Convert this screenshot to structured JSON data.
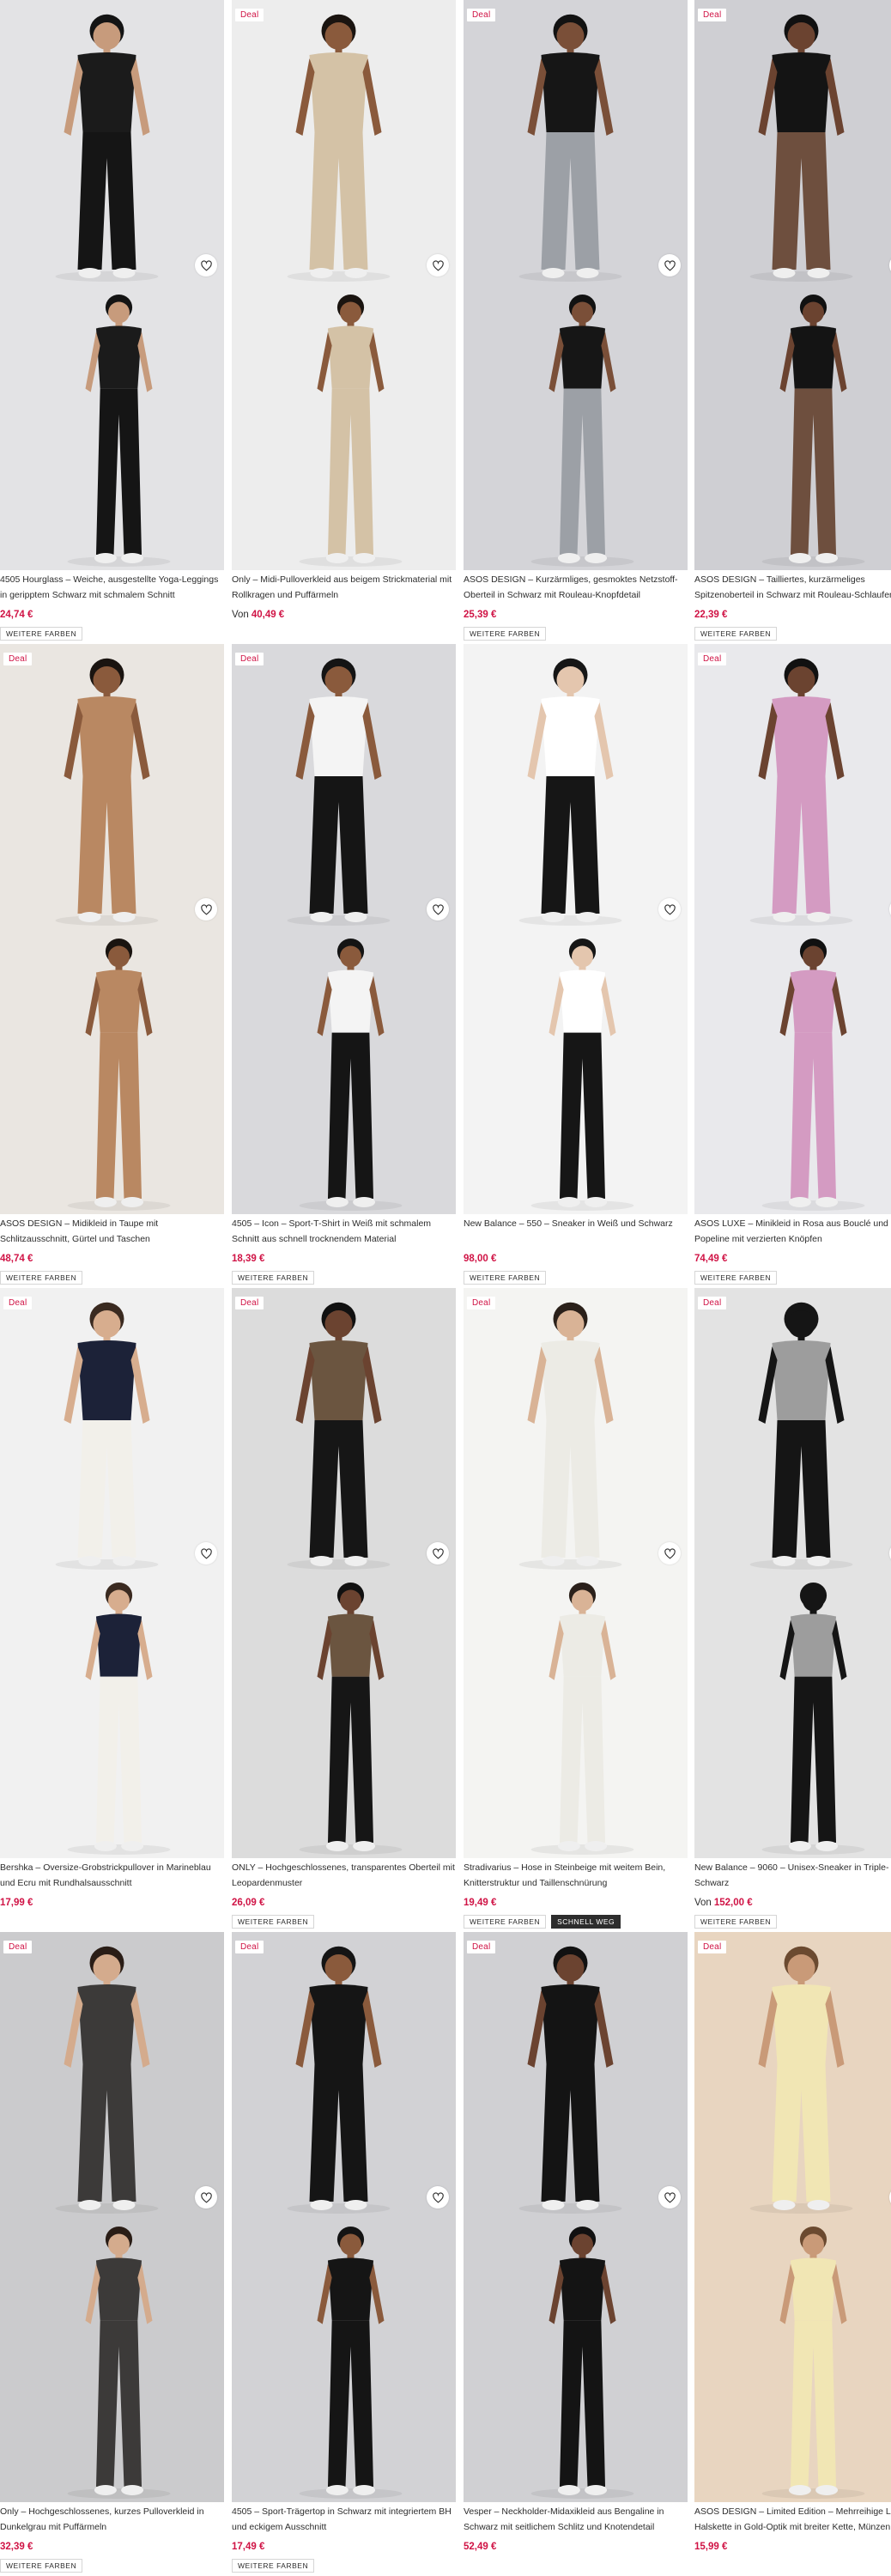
{
  "colors": {
    "deal_text": "#d01345",
    "price": "#d01345",
    "text": "#2d2d2d",
    "chip_border": "#d6d6d6"
  },
  "products": [
    {
      "deal": "",
      "title": "4505 Hourglass – Weiche, ausgestellte Yoga-Leggings in geripptem Schwarz mit schmalem Schnitt",
      "price_prefix": "",
      "price": "24,74 €",
      "chips": [
        "WEITERE FARBEN"
      ],
      "palette": {
        "bg": "#e3e3e5",
        "top": "#1b1b1b",
        "bottom": "#151515",
        "skin": "#c79b7c",
        "hair": "#141414"
      }
    },
    {
      "deal": "Deal",
      "title": "Only – Midi-Pulloverkleid aus beigem Strickmaterial mit Rollkragen und Puffärmeln",
      "price_prefix": "Von",
      "price": "40,49 €",
      "chips": [],
      "palette": {
        "bg": "#ededed",
        "top": "#d4c2a6",
        "bottom": "#d4c2a6",
        "skin": "#8a5a3c",
        "hair": "#1a1410"
      }
    },
    {
      "deal": "Deal",
      "title": "ASOS DESIGN – Kurzärmliges, gesmoktes Netzstoff-Oberteil in Schwarz mit Rouleau-Knopfdetail",
      "price_prefix": "",
      "price": "25,39 €",
      "chips": [
        "WEITERE FARBEN"
      ],
      "palette": {
        "bg": "#d4d4d8",
        "top": "#161616",
        "bottom": "#9ca0a6",
        "skin": "#7a4f38",
        "hair": "#121212"
      }
    },
    {
      "deal": "Deal",
      "title": "ASOS DESIGN – Tailliertes, kurzärmeliges Spitzenoberteil in Schwarz mit Rouleau-Schlaufen",
      "price_prefix": "",
      "price": "22,39 €",
      "chips": [
        "WEITERE FARBEN"
      ],
      "palette": {
        "bg": "#cfcfd3",
        "top": "#141414",
        "bottom": "#6e4f3e",
        "skin": "#6b4330",
        "hair": "#111111"
      }
    },
    {
      "deal": "Deal",
      "title": "ASOS DESIGN – Midikleid in Taupe mit Schlitzausschnitt, Gürtel und Taschen",
      "price_prefix": "",
      "price": "48,74 €",
      "chips": [
        "WEITERE FARBEN"
      ],
      "palette": {
        "bg": "#eae6e1",
        "top": "#b98862",
        "bottom": "#b98862",
        "skin": "#8a5a3c",
        "hair": "#1a1410"
      }
    },
    {
      "deal": "Deal",
      "title": "4505 – Icon – Sport-T-Shirt in Weiß mit schmalem Schnitt aus schnell trocknendem Material",
      "price_prefix": "",
      "price": "18,39 €",
      "chips": [
        "WEITERE FARBEN"
      ],
      "palette": {
        "bg": "#d9d9dc",
        "top": "#f4f4f4",
        "bottom": "#151515",
        "skin": "#8a5a3c",
        "hair": "#141414"
      }
    },
    {
      "deal": "",
      "title": "New Balance – 550 – Sneaker in Weiß und Schwarz",
      "price_prefix": "",
      "price": "98,00 €",
      "chips": [
        "WEITERE FARBEN"
      ],
      "palette": {
        "bg": "#f3f3f3",
        "top": "#ffffff",
        "bottom": "#161616",
        "skin": "#e4c6ae",
        "hair": "#161616"
      }
    },
    {
      "deal": "Deal",
      "title": "ASOS LUXE – Minikleid in Rosa aus Bouclé und Popeline mit verzierten Knöpfen",
      "price_prefix": "",
      "price": "74,49 €",
      "chips": [
        "WEITERE FARBEN"
      ],
      "palette": {
        "bg": "#e9e9ec",
        "top": "#d49bc2",
        "bottom": "#d49bc2",
        "skin": "#6b4330",
        "hair": "#111111"
      }
    },
    {
      "deal": "Deal",
      "title": "Bershka – Oversize-Grobstrickpullover in Marineblau und Ecru mit Rundhalsausschnitt",
      "price_prefix": "",
      "price": "17,99 €",
      "chips": [],
      "palette": {
        "bg": "#f1f1f1",
        "top": "#1c2238",
        "bottom": "#f2f0ea",
        "skin": "#d7ad8e",
        "hair": "#3a2a20"
      }
    },
    {
      "deal": "Deal",
      "title": "ONLY – Hochgeschlossenes, transparentes Oberteil mit Leopardenmuster",
      "price_prefix": "",
      "price": "26,09 €",
      "chips": [
        "WEITERE FARBEN"
      ],
      "palette": {
        "bg": "#dcdcdc",
        "top": "#6b5540",
        "bottom": "#161616",
        "skin": "#6b4330",
        "hair": "#111111"
      }
    },
    {
      "deal": "Deal",
      "title": "Stradivarius – Hose in Steinbeige mit weitem Bein, Knitterstruktur und Taillenschnürung",
      "price_prefix": "",
      "price": "19,49 €",
      "chips": [
        "WEITERE FARBEN",
        "SCHNELL WEG"
      ],
      "palette": {
        "bg": "#f4f4f2",
        "top": "#ecebe5",
        "bottom": "#ecebe5",
        "skin": "#d9b396",
        "hair": "#2a201a"
      }
    },
    {
      "deal": "Deal",
      "title": "New Balance – 9060 – Unisex-Sneaker in Triple-Schwarz",
      "price_prefix": "Von",
      "price": "152,00 €",
      "chips": [
        "WEITERE FARBEN"
      ],
      "palette": {
        "bg": "#e3e3e3",
        "top": "#9d9d9d",
        "bottom": "#151515",
        "skin": "#151515",
        "hair": "#151515"
      }
    },
    {
      "deal": "Deal",
      "title": "Only – Hochgeschlossenes, kurzes Pulloverkleid in Dunkelgrau mit Puffärmeln",
      "price_prefix": "",
      "price": "32,39 €",
      "chips": [
        "WEITERE FARBEN"
      ],
      "palette": {
        "bg": "#cbcbcd",
        "top": "#3c3a39",
        "bottom": "#3c3a39",
        "skin": "#d4ab8d",
        "hair": "#2a1d16"
      }
    },
    {
      "deal": "Deal",
      "title": "4505 – Sport-Trägertop in Schwarz mit integriertem BH und eckigem Ausschnitt",
      "price_prefix": "",
      "price": "17,49 €",
      "chips": [
        "WEITERE FARBEN"
      ],
      "palette": {
        "bg": "#d2d2d5",
        "top": "#151515",
        "bottom": "#151515",
        "skin": "#8a5a3c",
        "hair": "#141414"
      }
    },
    {
      "deal": "Deal",
      "title": "Vesper – Neckholder-Midaxikleid aus Bengaline in Schwarz mit seitlichem Schlitz und Knotendetail",
      "price_prefix": "",
      "price": "52,49 €",
      "chips": [],
      "palette": {
        "bg": "#d0d0d3",
        "top": "#141414",
        "bottom": "#141414",
        "skin": "#6b4330",
        "hair": "#111111"
      }
    },
    {
      "deal": "Deal",
      "title": "ASOS DESIGN – Limited Edition – Mehrreihige Lasso-Halskette in Gold-Optik mit breiter Kette, Münzen",
      "price_prefix": "",
      "price": "15,99 €",
      "chips": [],
      "palette": {
        "bg": "#e8d5c0",
        "top": "#f1e6b4",
        "bottom": "#f1e6b4",
        "skin": "#c99a78",
        "hair": "#6b4a30"
      }
    }
  ]
}
